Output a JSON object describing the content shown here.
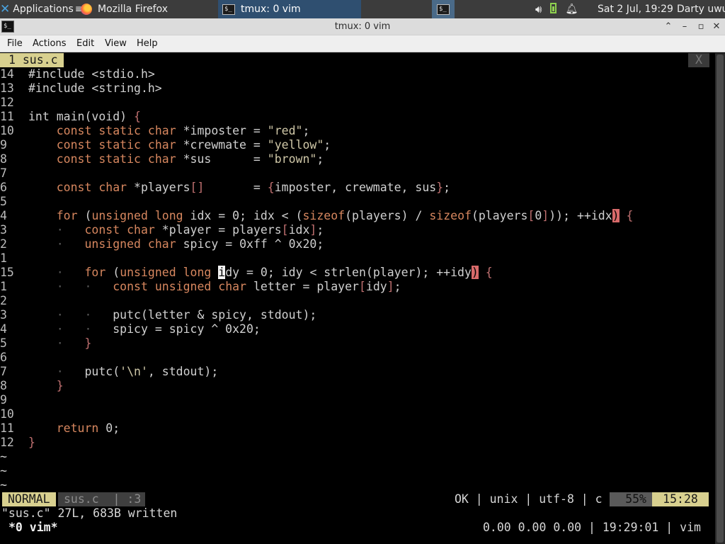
{
  "panel": {
    "applications_label": "Applications",
    "tasks": [
      {
        "label": "Mozilla Firefox"
      },
      {
        "label": "tmux: 0 vim"
      }
    ],
    "clock": "Sat  2 Jul, 19:29",
    "user": "Darty uwu"
  },
  "window": {
    "title": "tmux: 0 vim",
    "menu": [
      "File",
      "Actions",
      "Edit",
      "View",
      "Help"
    ]
  },
  "vim": {
    "tab_label": "1 sus.c",
    "tab_close": "X",
    "lines": [
      {
        "num": "14",
        "text": "#include <stdio.h>"
      },
      {
        "num": "13",
        "text": "#include <string.h>"
      },
      {
        "num": "12",
        "text": ""
      },
      {
        "num": "11",
        "text": "int main(void) {"
      },
      {
        "num": "10",
        "text": "    const static char *imposter = \"red\";"
      },
      {
        "num": "9",
        "text": "    const static char *crewmate = \"yellow\";"
      },
      {
        "num": "8",
        "text": "    const static char *sus      = \"brown\";"
      },
      {
        "num": "7",
        "text": ""
      },
      {
        "num": "6",
        "text": "    const char *players[]       = {imposter, crewmate, sus};"
      },
      {
        "num": "5",
        "text": ""
      },
      {
        "num": "4",
        "text": "    for (unsigned long idx = 0; idx < (sizeof(players) / sizeof(players[0])); ++idx) {"
      },
      {
        "num": "3",
        "text": "    ·   const char *player = players[idx];"
      },
      {
        "num": "2",
        "text": "    ·   unsigned char spicy = 0xff ^ 0x20;"
      },
      {
        "num": "1",
        "text": ""
      },
      {
        "num": "15",
        "text": "    ·   for (unsigned long idy = 0; idy < strlen(player); ++idy) {"
      },
      {
        "num": "1",
        "text": "    ·   ·   const unsigned char letter = player[idy];"
      },
      {
        "num": "2",
        "text": ""
      },
      {
        "num": "3",
        "text": "    ·   ·   putc(letter & spicy, stdout);"
      },
      {
        "num": "4",
        "text": "    ·   ·   spicy = spicy ^ 0x20;"
      },
      {
        "num": "5",
        "text": "    ·   }"
      },
      {
        "num": "6",
        "text": ""
      },
      {
        "num": "7",
        "text": "    ·   putc('\\n', stdout);"
      },
      {
        "num": "8",
        "text": "    }"
      },
      {
        "num": "9",
        "text": ""
      },
      {
        "num": "10",
        "text": ""
      },
      {
        "num": "11",
        "text": "    return 0;"
      },
      {
        "num": "12",
        "text": "}"
      }
    ],
    "tildes": [
      "~",
      "~",
      "~"
    ],
    "status": {
      "mode": "NORMAL",
      "file": "sus.c  | :3",
      "info": "OK | unix | utf-8 | c",
      "percent": "55%",
      "position": "15:28"
    },
    "cmdline": "\"sus.c\" 27L, 683B written"
  },
  "tmux": {
    "window": "*0 vim*",
    "right": "0.00 0.00 0.00 | 19:29:01 | vim"
  }
}
